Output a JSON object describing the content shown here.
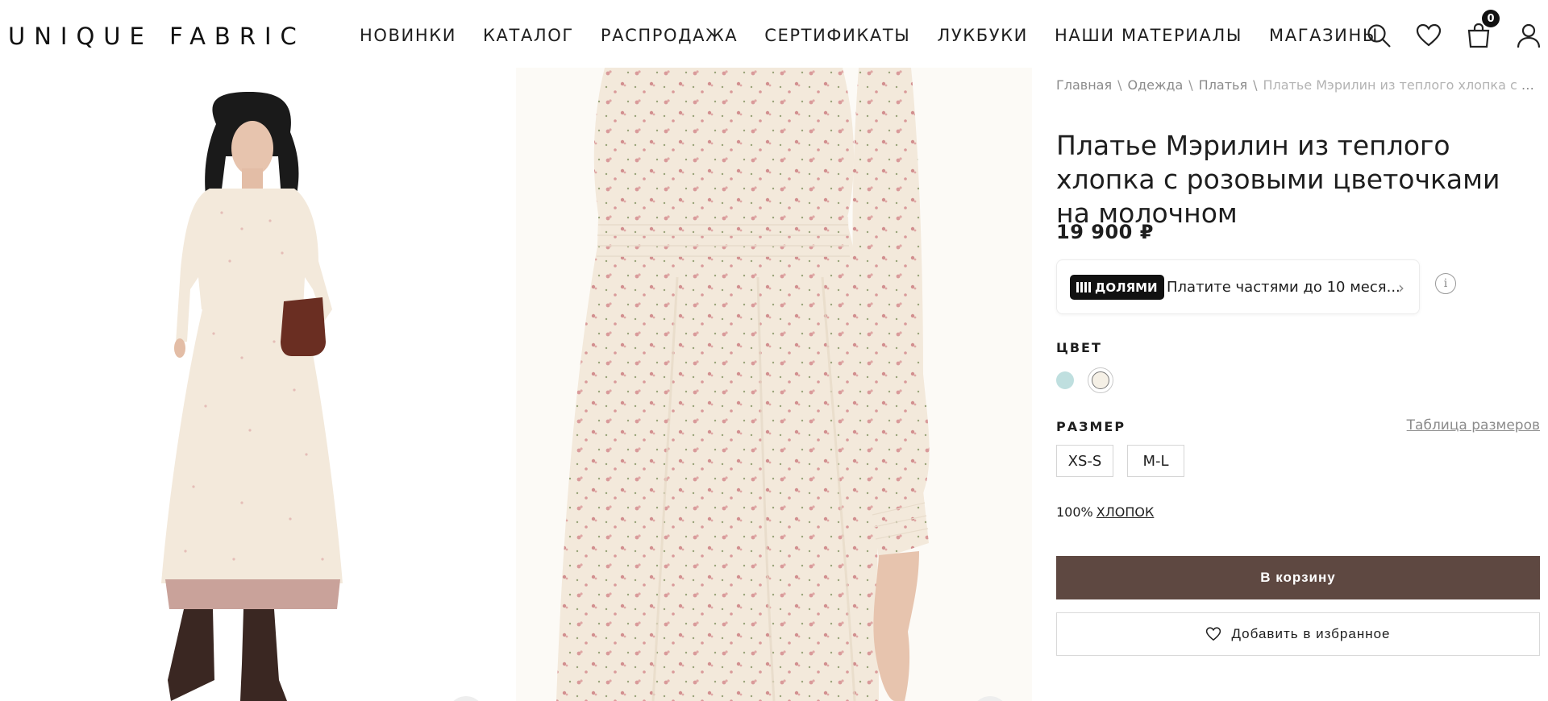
{
  "header": {
    "logo": "UNIQUE FABRIC",
    "nav": [
      "НОВИНКИ",
      "КАТАЛОГ",
      "РАСПРОДАЖА",
      "СЕРТИФИКАТЫ",
      "ЛУКБУКИ",
      "НАШИ МАТЕРИАЛЫ",
      "МАГАЗИНЫ"
    ],
    "icons": [
      "search-icon",
      "heart-icon",
      "bag-icon",
      "user-icon"
    ],
    "cart_count": "0"
  },
  "breadcrumb": [
    "Главная",
    "Одежда",
    "Платья",
    "Платье Мэрилин из теплого хлопка с розовыми цветочками на молочном"
  ],
  "product": {
    "title": "Платье Мэрилин из теплого хлопка с розовыми цветочками на молочном",
    "price": "19 900 ₽",
    "dolyami_badge": "ДОЛЯМИ",
    "dolyami_text": "Платите частями до 10 меся...",
    "color_label": "ЦВЕТ",
    "colors": [
      "#bfdfdf",
      "#f5f0e6"
    ],
    "size_label": "РАЗМЕР",
    "size_table": "Таблица размеров",
    "sizes": [
      "XS-S",
      "M-L"
    ],
    "composition_value": "100%",
    "composition_material": "ХЛОПОК",
    "add_to_cart": "В корзину",
    "add_to_favorites": "Добавить в избранное"
  },
  "colors": {
    "cart_button": "#5e4841",
    "dress_base": "#f3e9db",
    "flower": "#d99a9a"
  }
}
